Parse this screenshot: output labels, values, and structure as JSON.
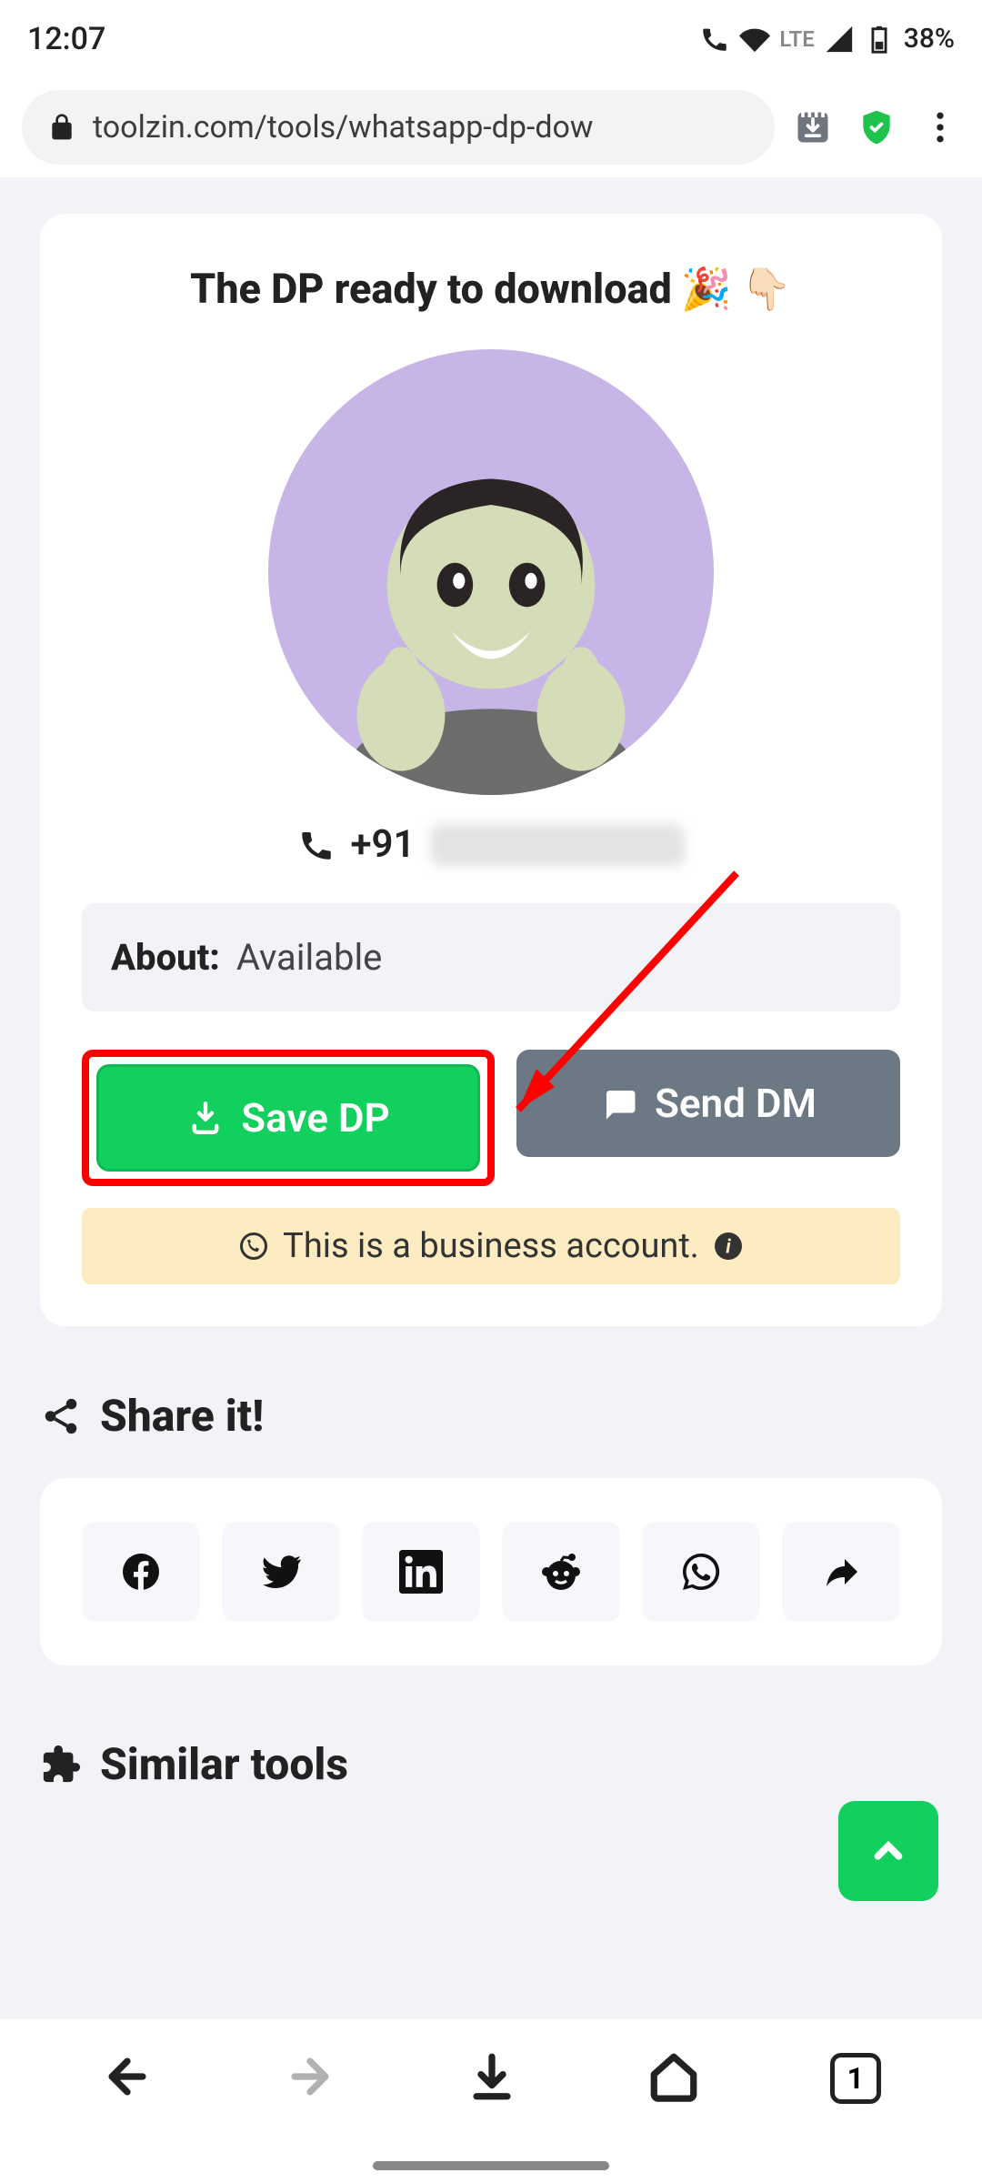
{
  "status": {
    "time": "12:07",
    "network": "LTE",
    "battery": "38%"
  },
  "browser": {
    "url": "toolzin.com/tools/whatsapp-dp-dow",
    "tabs": "1"
  },
  "card": {
    "title": "The DP ready to download",
    "phone_prefix": "+91",
    "about_label": "About:",
    "about_value": "Available",
    "save_label": "Save DP",
    "send_label": "Send DM",
    "notice": "This is a business account."
  },
  "sections": {
    "share": "Share it!",
    "similar": "Similar tools"
  },
  "share_icons": [
    "facebook",
    "twitter",
    "linkedin",
    "reddit",
    "whatsapp",
    "share"
  ]
}
